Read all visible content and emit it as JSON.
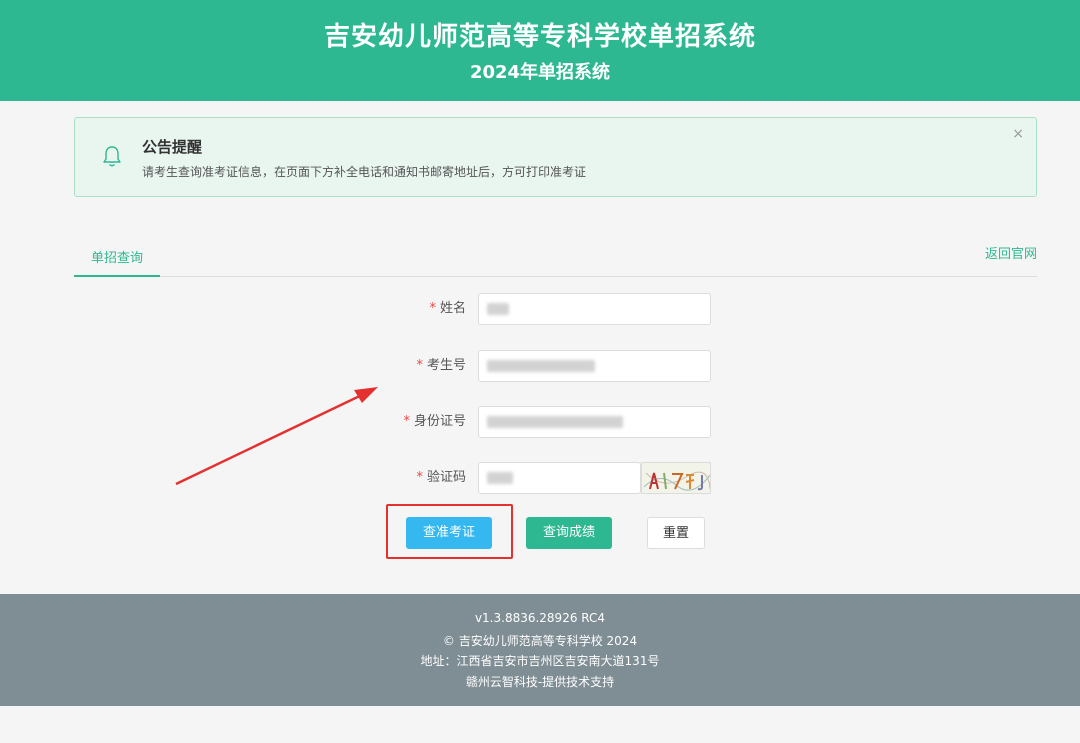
{
  "header": {
    "title": "吉安幼儿师范高等专科学校单招系统",
    "subtitle": "2024年单招系统"
  },
  "notice": {
    "icon": "bell-icon",
    "title": "公告提醒",
    "text": "请考生查询准考证信息，在页面下方补全电话和通知书邮寄地址后，方可打印准考证",
    "close_icon": "close-icon",
    "close_label": "×"
  },
  "tabs": {
    "active": "单招查询",
    "back_link": "返回官网"
  },
  "form": {
    "required_mark": "*",
    "name_label": "姓名",
    "exam_no_label": "考生号",
    "id_label": "身份证号",
    "captcha_label": "验证码",
    "name_value": "",
    "exam_no_value": "",
    "id_value": "",
    "captcha_value": ""
  },
  "buttons": {
    "query_ticket": "查准考证",
    "query_score": "查询成绩",
    "reset": "重置"
  },
  "footer": {
    "version": "v1.3.8836.28926 RC4",
    "copyright": "© 吉安幼儿师范高等专科学校 2024",
    "address": "地址：江西省吉安市吉州区吉安南大道131号",
    "support": "赣州云智科技-提供技术支持"
  },
  "colors": {
    "brand": "#2eb891",
    "primary_button": "#35b8ef",
    "highlight": "#e53030",
    "footer": "#7f8d94"
  }
}
